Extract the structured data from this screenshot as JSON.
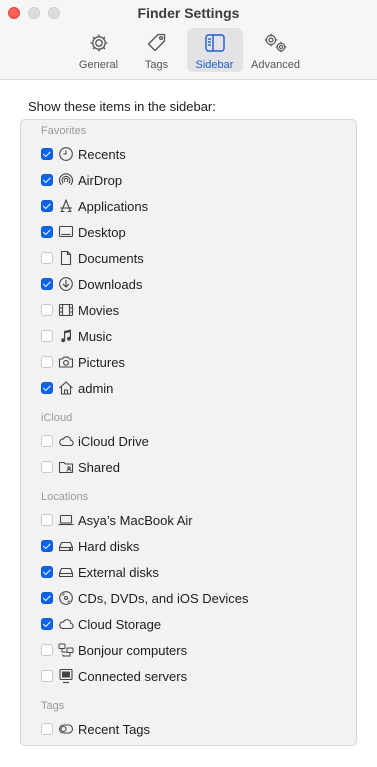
{
  "window": {
    "title": "Finder Settings"
  },
  "tabs": [
    {
      "label": "General",
      "icon": "gear-icon",
      "active": false
    },
    {
      "label": "Tags",
      "icon": "tag-icon",
      "active": false
    },
    {
      "label": "Sidebar",
      "icon": "sidebar-icon",
      "active": true
    },
    {
      "label": "Advanced",
      "icon": "gears-icon",
      "active": false
    }
  ],
  "heading": "Show these items in the sidebar:",
  "colors": {
    "accent": "#0a64e8",
    "active_tab_text": "#1a5fd0",
    "close": "#ff5f57"
  },
  "sections": {
    "favorites": {
      "label": "Favorites",
      "items": [
        {
          "label": "Recents",
          "checked": true,
          "icon": "clock-icon"
        },
        {
          "label": "AirDrop",
          "checked": true,
          "icon": "airdrop-icon"
        },
        {
          "label": "Applications",
          "checked": true,
          "icon": "applications-icon"
        },
        {
          "label": "Desktop",
          "checked": true,
          "icon": "desktop-icon"
        },
        {
          "label": "Documents",
          "checked": false,
          "icon": "document-icon"
        },
        {
          "label": "Downloads",
          "checked": true,
          "icon": "download-icon"
        },
        {
          "label": "Movies",
          "checked": false,
          "icon": "film-icon"
        },
        {
          "label": "Music",
          "checked": false,
          "icon": "music-note-icon"
        },
        {
          "label": "Pictures",
          "checked": false,
          "icon": "camera-icon"
        },
        {
          "label": "admin",
          "checked": true,
          "icon": "home-icon"
        }
      ]
    },
    "icloud": {
      "label": "iCloud",
      "items": [
        {
          "label": "iCloud Drive",
          "checked": false,
          "icon": "cloud-icon"
        },
        {
          "label": "Shared",
          "checked": false,
          "icon": "shared-folder-icon"
        }
      ]
    },
    "locations": {
      "label": "Locations",
      "items": [
        {
          "label": "Asya’s MacBook Air",
          "checked": false,
          "icon": "laptop-icon"
        },
        {
          "label": "Hard disks",
          "checked": true,
          "icon": "hard-disk-icon"
        },
        {
          "label": "External disks",
          "checked": true,
          "icon": "external-disk-icon"
        },
        {
          "label": "CDs, DVDs, and iOS Devices",
          "checked": true,
          "icon": "disc-icon"
        },
        {
          "label": "Cloud Storage",
          "checked": true,
          "icon": "cloud-icon"
        },
        {
          "label": "Bonjour computers",
          "checked": false,
          "icon": "bonjour-icon"
        },
        {
          "label": "Connected servers",
          "checked": false,
          "icon": "server-icon"
        }
      ]
    },
    "tags": {
      "label": "Tags",
      "items": [
        {
          "label": "Recent Tags",
          "checked": false,
          "icon": "tag-outline-icon"
        }
      ]
    }
  }
}
